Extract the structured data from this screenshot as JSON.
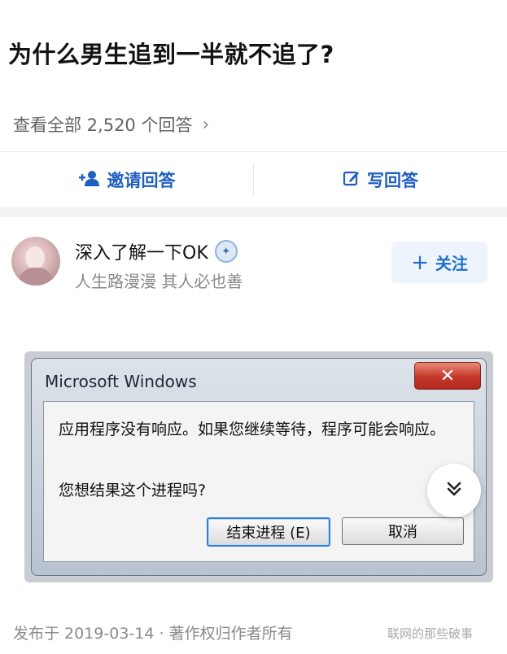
{
  "question": {
    "title": "为什么男生追到一半就不追了?",
    "view_all": "查看全部 2,520 个回答",
    "chevron": "›"
  },
  "actions": {
    "invite": {
      "label": "邀请回答",
      "icon": "invite-user-icon"
    },
    "write": {
      "label": "写回答",
      "icon": "edit-icon"
    }
  },
  "answer": {
    "author_name": "深入了解一下OK",
    "author_bio": "人生路漫漫 其人必也善",
    "follow_label": "关注",
    "follow_icon": "+",
    "published": "发布于 2019-03-14 · 著作权归作者所有"
  },
  "dialog": {
    "title": "Microsoft Windows",
    "close": "✕",
    "message1": "应用程序没有响应。如果您继续等待，程序可能会响应。",
    "message2": "您想结果这个进程吗?",
    "end_button": "结束进程 (E)",
    "cancel_button": "取消"
  },
  "watermark": "联网的那些破事",
  "colors": {
    "accent": "#1f5fbf",
    "follow_bg": "#eef4fb"
  }
}
